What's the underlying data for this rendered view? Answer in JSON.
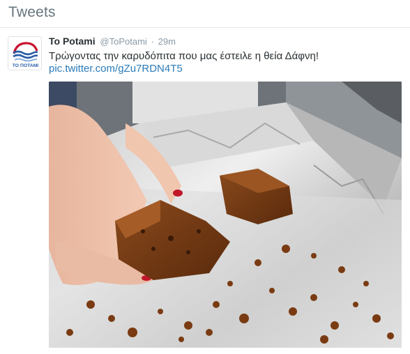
{
  "header": {
    "title": "Tweets"
  },
  "tweet": {
    "avatar_text": "ΤΟ ΠΟΤΑΜΙ",
    "fullname": "To Potami",
    "username": "@ToPotami",
    "separator": "·",
    "time": "29m",
    "text": "Τρώγοντας την καρυδόπιτα που μας έστειλε η θεία Δάφνη!",
    "link": "pic.twitter.com/gZu7RDN4T5"
  },
  "colors": {
    "link": "#2b7bb9",
    "name": "#292f33",
    "muted": "#8899a6",
    "logo_blue": "#2a5ea8",
    "logo_red": "#c8102e"
  },
  "icons": {
    "avatar": "to-potami-logo"
  }
}
